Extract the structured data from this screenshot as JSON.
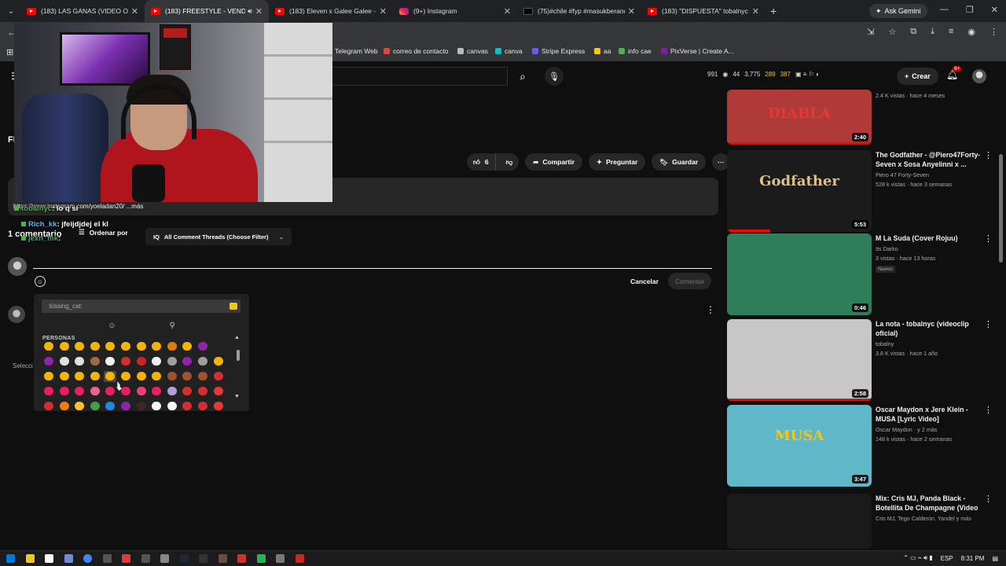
{
  "browser": {
    "tabs": [
      {
        "title": "(183) LAS GANAS (VIDEO OFICI",
        "icon": "youtube-icon",
        "active": false
      },
      {
        "title": "(183) FREESTYLE - VENDET",
        "icon": "youtube-icon",
        "active": true
      },
      {
        "title": "(183) Eleven x Galee Galee - So",
        "icon": "youtube-icon",
        "active": false
      },
      {
        "title": "(9+) Instagram",
        "icon": "instagram-icon",
        "active": false
      },
      {
        "title": "(75)#chile #fyp #masukberand",
        "icon": "tiktok-icon",
        "active": false
      },
      {
        "title": "(183) \"DISPUESTA\" tobalnyc ft",
        "icon": "youtube-icon",
        "active": false
      }
    ],
    "gemini_label": "Ask Gemini",
    "bookmarks": [
      "Telegram Web",
      "correo de contacto",
      "canvas",
      "canva",
      "Stripe Express",
      "aa",
      "info cae",
      "PixVerse | Create A..."
    ]
  },
  "youtube_header": {
    "stats": {
      "s1": "991",
      "s2": "44",
      "s3": "3,775",
      "s4": "289",
      "s5": "387"
    },
    "create_label": "Crear",
    "notifications": "9+"
  },
  "video": {
    "title_fragment": "FR",
    "likes": "6",
    "share_label": "Compartir",
    "ask_label": "Preguntar",
    "save_label": "Guardar",
    "description_more": "https://www.instagram.com/yoeladan20/ ...más"
  },
  "chat": [
    {
      "user": "tobalnyc",
      "msg": ": lo q si"
    },
    {
      "user": "Rich_kk",
      "msg": ": jfeijdjdej el kl"
    },
    {
      "user": "jexn_mk",
      "msg": ":"
    }
  ],
  "comments": {
    "count": "1 comentario",
    "sort_label": "Ordenar por",
    "filter_label": "All Comment Threads (Choose Filter)",
    "cancel_label": "Cancelar",
    "submit_label": "Comentar",
    "select_fragment": "Selecci"
  },
  "emoji_picker": {
    "search_value": ":kissing_cat:",
    "section_label": "PERSONAS",
    "rows": [
      [
        "#f5b400",
        "#f5b400",
        "#f5b400",
        "#f5b400",
        "#f5b400",
        "#f5b400",
        "#f5b400",
        "#f5b400",
        "#e07b00",
        "#f5b400",
        "#8e24aa"
      ],
      [
        "#8e24aa",
        "#e0e0e0",
        "#e0e0e0",
        "#9c6b3f",
        "#f0f0f0",
        "#d32f2f",
        "#c62828",
        "#eeeeee",
        "#9e9e9e",
        "#8e24aa",
        "#9e9e9e",
        "#f5b400"
      ],
      [
        "#f5b400",
        "#f5b400",
        "#f5b400",
        "#f5b400",
        "#f5b400",
        "#f5b400",
        "#f5b400",
        "#f5b400",
        "#a0522d",
        "#a0522d",
        "#a0522d",
        "#d32f2f"
      ],
      [
        "#e91e63",
        "#e91e63",
        "#e91e63",
        "#f06292",
        "#e91e63",
        "#e91e63",
        "#ec407a",
        "#e91e63",
        "#b39ddb",
        "#d32f2f",
        "#d32f2f",
        "#e53935"
      ],
      [
        "#d32f2f",
        "#f57c00",
        "#fbc02d",
        "#43a047",
        "#1e88e5",
        "#8e24aa",
        "#3e2723",
        "#f5f5f5",
        "#f5f5f5",
        "#d32f2f",
        "#d32f2f",
        "#e53935"
      ]
    ]
  },
  "recommendations": [
    {
      "title": "",
      "channel": "",
      "meta": "2.4 K vistas · hace 4 meses",
      "duration": "2:40",
      "badge": "",
      "thumb": "#b0393a",
      "progress": 1.0,
      "thumb_text": "DIABLA"
    },
    {
      "title": "The Godfather - @Piero47Forty-Seven x Sosa Anyelinni x ...",
      "channel": "Piero 47 Forty-Seven",
      "meta": "528 k vistas · hace 3 semanas",
      "duration": "5:53",
      "badge": "",
      "thumb": "#1b1b1b",
      "progress": 0.3,
      "thumb_text": "Godfather"
    },
    {
      "title": "M La Suda (Cover Rojuu)",
      "channel": "Its Darko",
      "meta": "3 vistas · hace 13 horas",
      "duration": "0:46",
      "badge": "Nuevo",
      "thumb": "#2e7d5b",
      "progress": 0,
      "thumb_text": ""
    },
    {
      "title": "La nota - tobalnyc (videoclip oficial)",
      "channel": "tobalny",
      "meta": "3.8 K vistas · hace 1 año",
      "duration": "2:58",
      "badge": "",
      "thumb": "#c7c7c7",
      "progress": 1.0,
      "thumb_text": ""
    },
    {
      "title": "Oscar Maydon x Jere Klein - MUSA [Lyric Video]",
      "channel": "Oscar Maydon · y 2 más",
      "meta": "148 k vistas · hace 2 semanas",
      "duration": "3:47",
      "badge": "",
      "thumb": "#5fb8c7",
      "progress": 0,
      "thumb_text": "MUSA"
    },
    {
      "title": "Mix: Cris MJ, Panda Black - Botellita De Champagne (Video ...",
      "channel": "Cris MJ, Tego Calderón, Yandel y más",
      "meta": "",
      "duration": "",
      "badge": "",
      "thumb": "#1a1a1a",
      "progress": 0,
      "thumb_text": ""
    }
  ],
  "taskbar": {
    "lang": "ESP",
    "time": "8:31 PM"
  },
  "colors": {
    "youtube_red": "#ff0000",
    "chat_green": "#4caf50",
    "bg": "#0f0f0f"
  }
}
